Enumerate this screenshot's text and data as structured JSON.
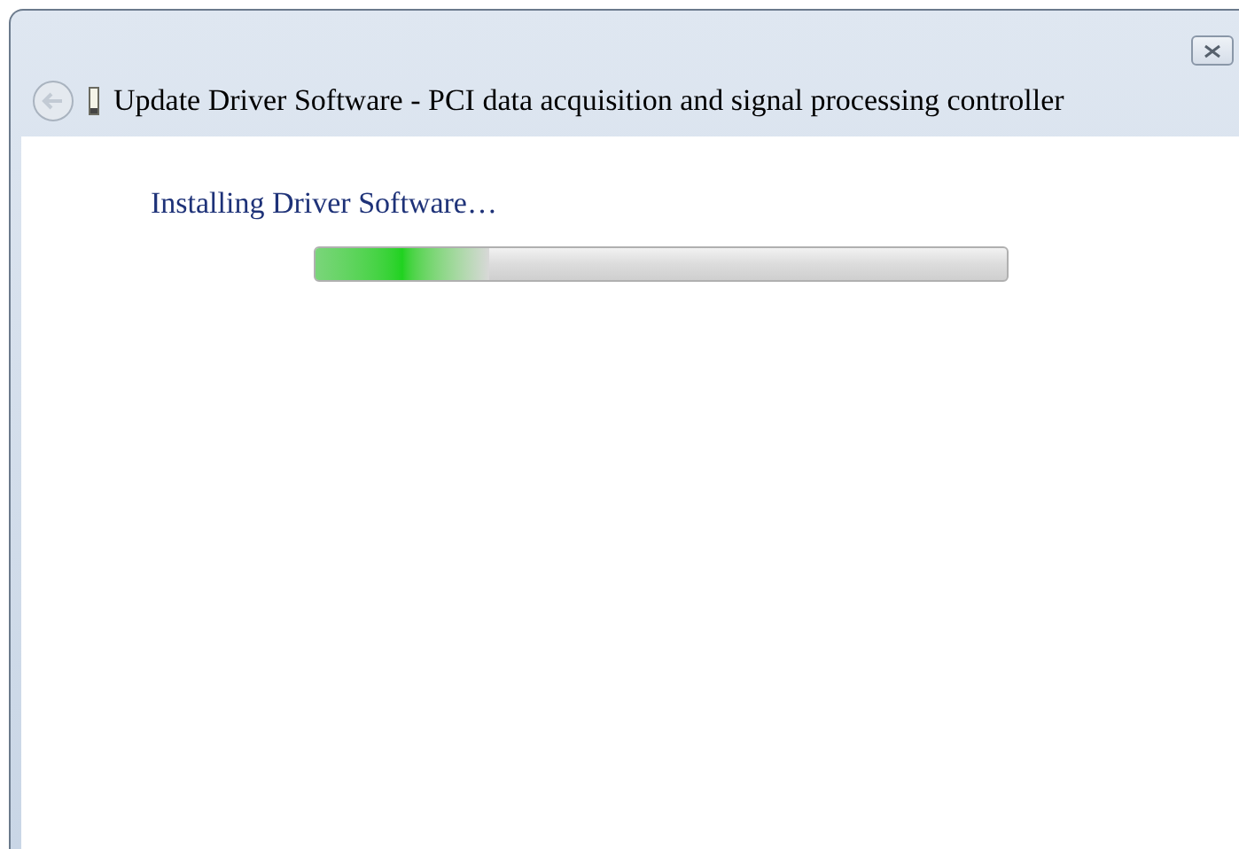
{
  "window": {
    "title": "Update Driver Software - PCI data acquisition and signal processing controller"
  },
  "heading": "Installing Driver Software…",
  "progress": {
    "level": 0.25
  }
}
